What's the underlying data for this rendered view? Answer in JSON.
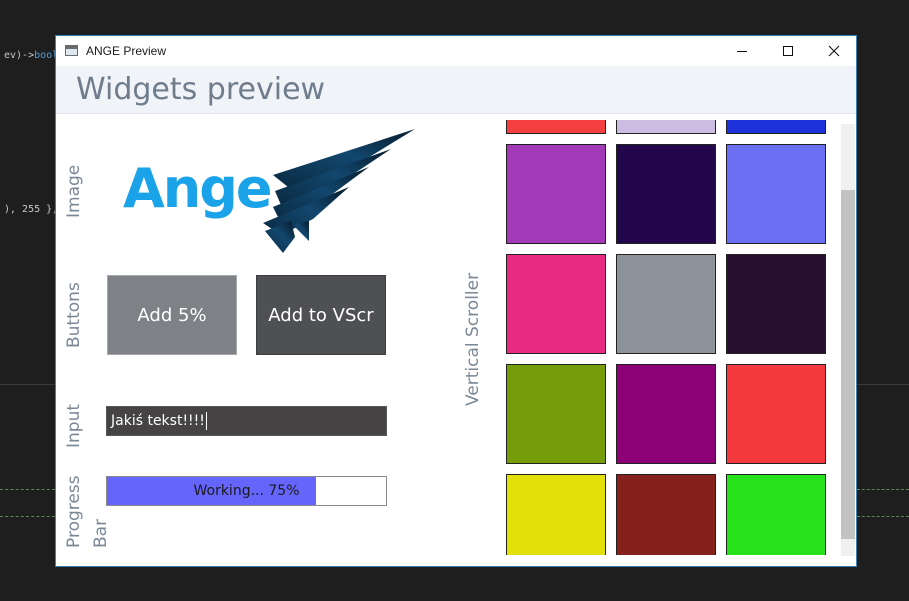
{
  "background_editor": {
    "snippet_1_prefix": "ev)->",
    "snippet_1_keyword": "bool",
    "snippet_2": "), 255 },"
  },
  "window": {
    "title": "ANGE Preview",
    "controls": {
      "minimize": "minimize-icon",
      "maximize": "maximize-icon",
      "close": "close-icon"
    }
  },
  "header": {
    "title": "Widgets preview"
  },
  "rows": {
    "image_label": "Image",
    "buttons_label": "Buttons",
    "input_label": "Input",
    "progress_label_line1": "Progress",
    "progress_label_line2": "Bar",
    "scroller_label": "Vertical Scroller"
  },
  "logo": {
    "text": "Ange",
    "text_color": "#1aa3e8",
    "wing_color": "#0c3350"
  },
  "buttons": {
    "add5_label": "Add 5%",
    "add_vscr_label": "Add to VScr"
  },
  "input": {
    "value": "Jakiś tekst!!!!"
  },
  "progress": {
    "text": "Working... 75%",
    "value": 0.75,
    "fill_color": "#6565fb"
  },
  "scroller": {
    "rows": [
      [
        "#f44040",
        "#cebde3",
        "#1e32dc"
      ],
      [
        "#a23ab7",
        "#23074d",
        "#6a6ef0"
      ],
      [
        "#e92a83",
        "#8c939b",
        "#270f2f"
      ],
      [
        "#779c0a",
        "#8c0176",
        "#f43a3f"
      ],
      [
        "#e3e009",
        "#86201b",
        "#27e21a"
      ]
    ],
    "scroll_position": 0.17
  }
}
